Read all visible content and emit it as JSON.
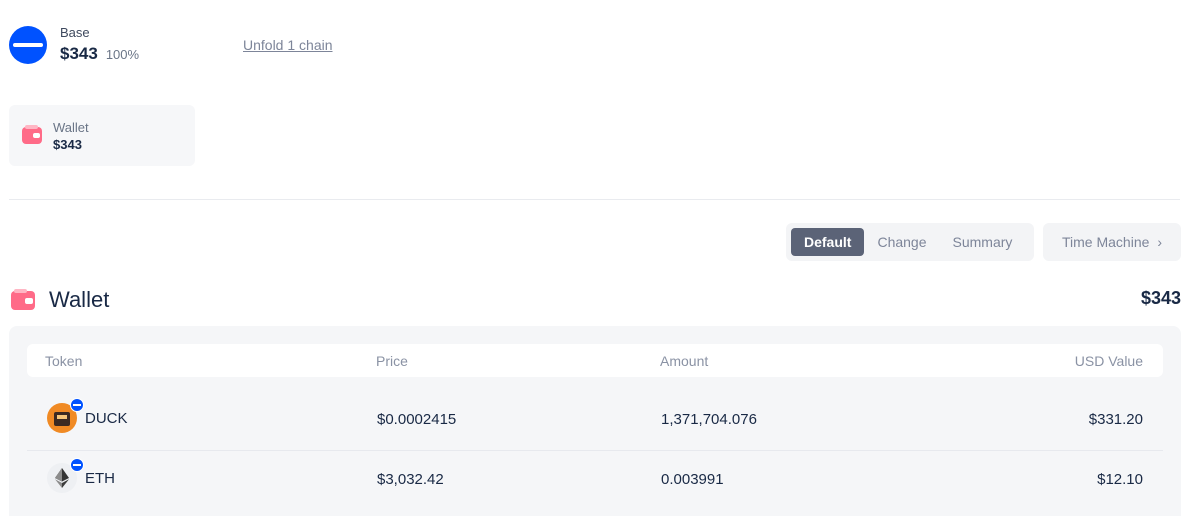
{
  "chain": {
    "name": "Base",
    "value": "$343",
    "percent": "100%",
    "unfold_label": "Unfold 1 chain",
    "color": "#0052ff"
  },
  "wallet_card": {
    "label": "Wallet",
    "value": "$343"
  },
  "view_tabs": {
    "items": [
      {
        "label": "Default",
        "active": true
      },
      {
        "label": "Change",
        "active": false
      },
      {
        "label": "Summary",
        "active": false
      }
    ],
    "time_machine_label": "Time Machine"
  },
  "wallet_section": {
    "title": "Wallet",
    "total": "$343"
  },
  "table": {
    "columns": [
      "Token",
      "Price",
      "Amount",
      "USD Value"
    ],
    "rows": [
      {
        "icon": "duck-token-icon",
        "symbol": "DUCK",
        "price": "$0.0002415",
        "amount": "1,371,704.076",
        "usd_value": "$331.20"
      },
      {
        "icon": "eth-token-icon",
        "symbol": "ETH",
        "price": "$3,032.42",
        "amount": "0.003991",
        "usd_value": "$12.10"
      }
    ]
  },
  "colors": {
    "accent": "#0052ff",
    "wallet": "#ff6b88",
    "active_tab": "#5b6377"
  }
}
